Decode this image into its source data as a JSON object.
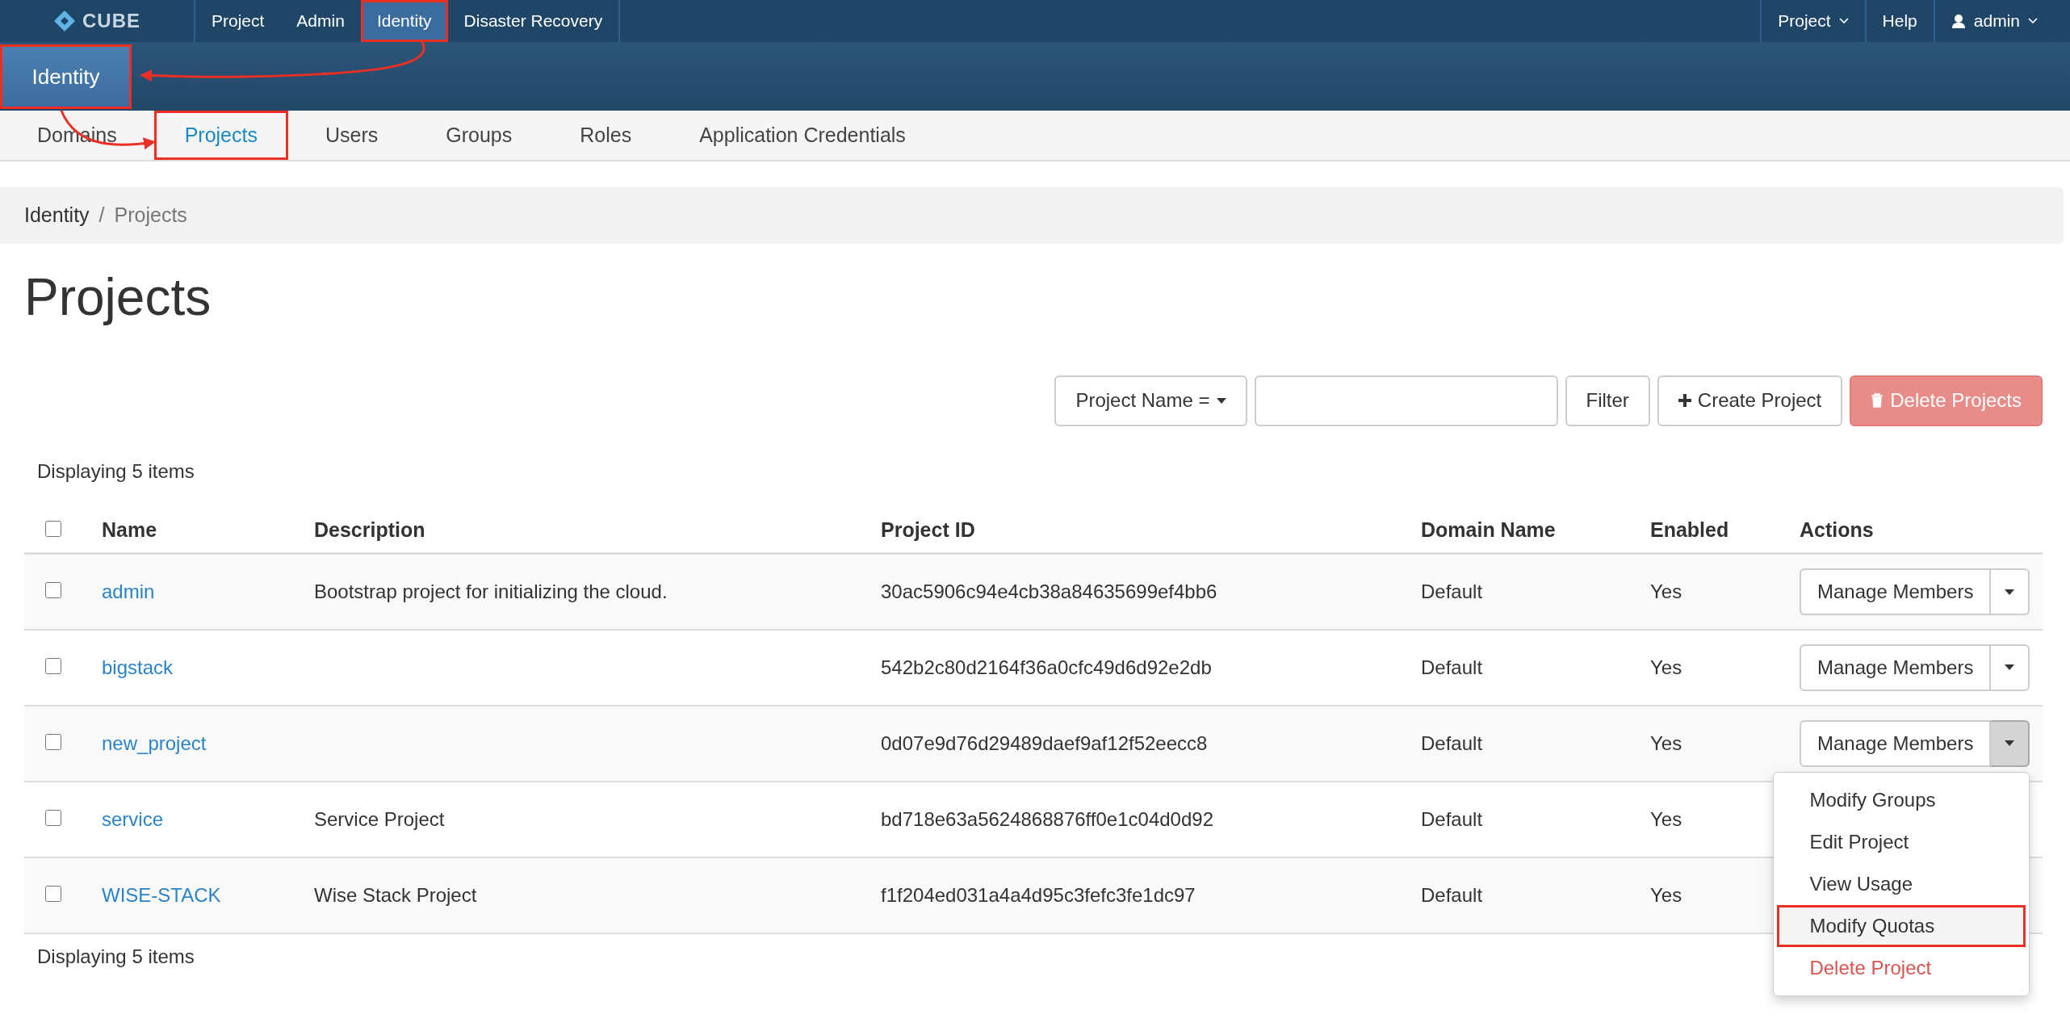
{
  "top_nav": {
    "logo_text": "CUBE",
    "items": [
      {
        "label": "Project",
        "selected": false,
        "highlighted": false
      },
      {
        "label": "Admin",
        "selected": false,
        "highlighted": false
      },
      {
        "label": "Identity",
        "selected": true,
        "highlighted": true
      },
      {
        "label": "Disaster Recovery",
        "selected": false,
        "highlighted": false
      }
    ],
    "right_items": [
      {
        "label": "Project",
        "kind": "dropdown"
      },
      {
        "label": "Help",
        "kind": "link"
      },
      {
        "label": "admin",
        "kind": "user"
      }
    ]
  },
  "panel": {
    "label": "Identity",
    "highlighted": true
  },
  "tabs": [
    {
      "label": "Domains",
      "selected": false,
      "highlighted": false
    },
    {
      "label": "Projects",
      "selected": true,
      "highlighted": true
    },
    {
      "label": "Users",
      "selected": false,
      "highlighted": false
    },
    {
      "label": "Groups",
      "selected": false,
      "highlighted": false
    },
    {
      "label": "Roles",
      "selected": false,
      "highlighted": false
    },
    {
      "label": "Application Credentials",
      "selected": false,
      "highlighted": false
    }
  ],
  "breadcrumb": {
    "items": [
      "Identity",
      "Projects"
    ],
    "separator": "/"
  },
  "page_title": "Projects",
  "toolbar": {
    "filter_field": "Project Name =",
    "filter_button": "Filter",
    "create_button": "Create Project",
    "delete_button": {
      "label": "Delete Projects",
      "disabled": true
    }
  },
  "table": {
    "count_top": "Displaying 5 items",
    "select_all": {
      "checked": false
    },
    "columns": [
      "Name",
      "Description",
      "Project ID",
      "Domain Name",
      "Enabled",
      "Actions"
    ],
    "rows": [
      {
        "checked": false,
        "name": "admin",
        "description": "Bootstrap project for initializing the cloud.",
        "project_id": "30ac5906c94e4cb38a84635699ef4bb6",
        "domain": "Default",
        "enabled": "Yes",
        "action": "Manage Members",
        "expanded": false
      },
      {
        "checked": false,
        "name": "bigstack",
        "project_id": "542b2c80d2164f36a0cfc49d6d92e2db",
        "domain": "Default",
        "enabled": "Yes",
        "action": "Manage Members",
        "expanded": false
      },
      {
        "checked": false,
        "name": "new_project",
        "project_id": "0d07e9d76d29489daef9af12f52eecc8",
        "domain": "Default",
        "enabled": "Yes",
        "action": "Manage Members",
        "expanded": true
      },
      {
        "checked": false,
        "name": "service",
        "description": "Service Project",
        "project_id": "bd718e63a5624868876ff0e1c04d0d92",
        "domain": "Default",
        "enabled": "Yes",
        "expanded": false
      },
      {
        "checked": false,
        "name": "WISE-STACK",
        "description": "Wise Stack Project",
        "project_id": "f1f204ed031a4a4d95c3fefc3fe1dc97",
        "domain": "Default",
        "enabled": "Yes",
        "expanded": false
      }
    ],
    "count_bottom": "Displaying 5 items"
  },
  "dropdown_menu": {
    "items": [
      {
        "label": "Modify Groups",
        "kind": "normal",
        "highlighted": false
      },
      {
        "label": "Edit Project",
        "kind": "normal",
        "highlighted": false
      },
      {
        "label": "View Usage",
        "kind": "normal",
        "highlighted": false
      },
      {
        "label": "Modify Quotas",
        "kind": "normal",
        "highlighted": true
      },
      {
        "label": "Delete Project",
        "kind": "danger",
        "highlighted": false
      }
    ]
  }
}
